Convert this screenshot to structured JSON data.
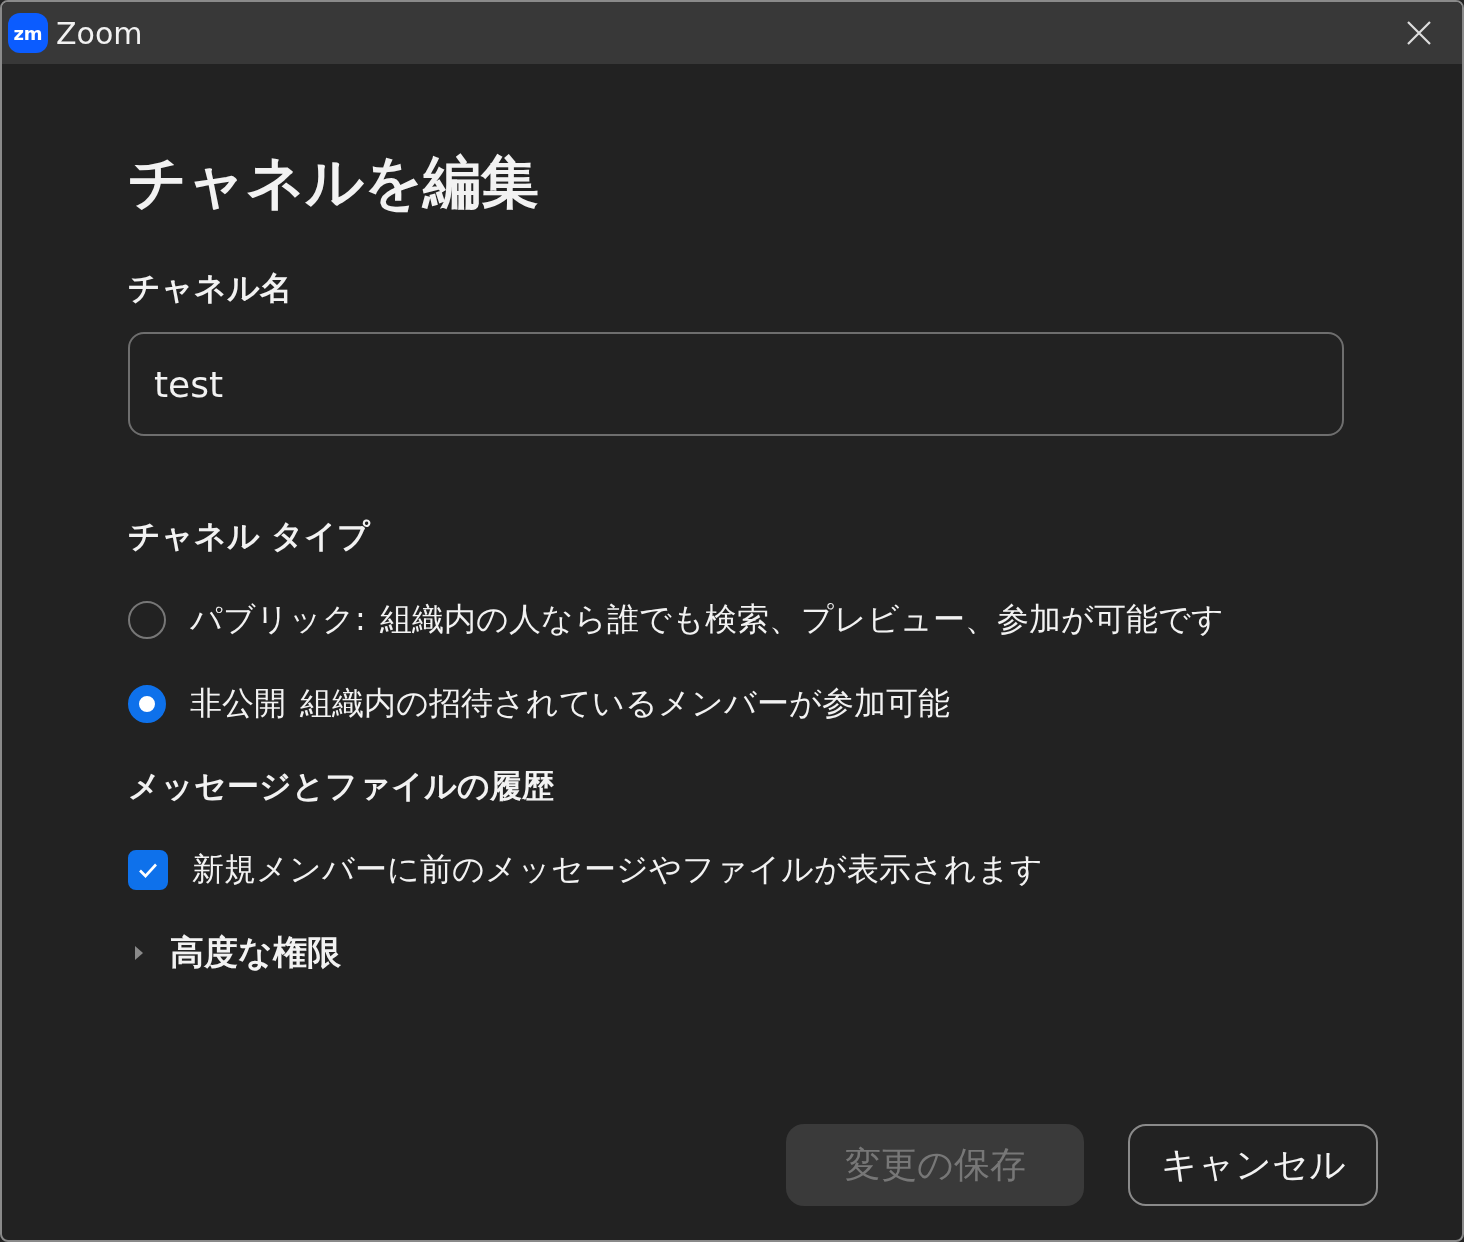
{
  "window": {
    "title": "Zoom",
    "logo_text": "zm"
  },
  "heading": "チャネルを編集",
  "name_field": {
    "label": "チャネル名",
    "value": "test"
  },
  "channel_type": {
    "label": "チャネル タイプ",
    "options": [
      {
        "label": "パブリック:",
        "description": "組織内の人なら誰でも検索、プレビュー、参加が可能です",
        "selected": false
      },
      {
        "label": "非公開",
        "description": "組織内の招待されているメンバーが参加可能",
        "selected": true
      }
    ]
  },
  "history": {
    "label": "メッセージとファイルの履歴",
    "checkbox": {
      "label": "新規メンバーに前のメッセージやファイルが表示されます",
      "checked": true
    }
  },
  "advanced": {
    "label": "高度な権限",
    "expanded": false
  },
  "buttons": [
    {
      "label": "変更の保存",
      "kind": "primary",
      "disabled": true
    },
    {
      "label": "キャンセル",
      "kind": "secondary",
      "disabled": false
    }
  ]
}
